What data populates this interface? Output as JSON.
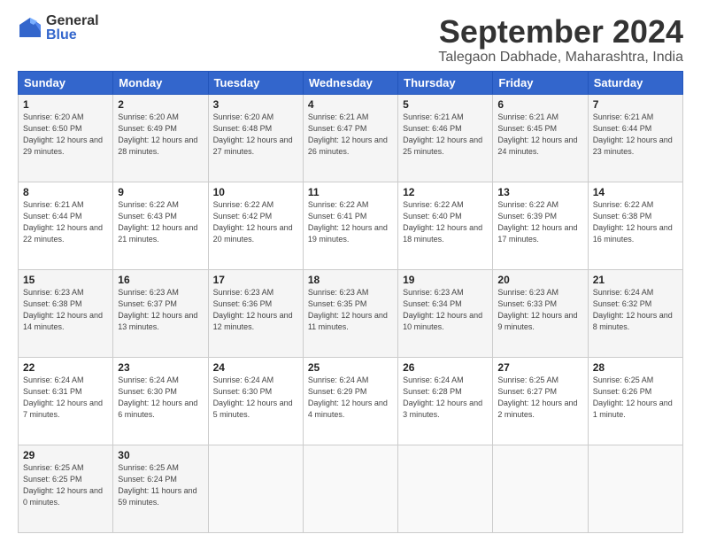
{
  "logo": {
    "general": "General",
    "blue": "Blue"
  },
  "title": "September 2024",
  "location": "Talegaon Dabhade, Maharashtra, India",
  "headers": [
    "Sunday",
    "Monday",
    "Tuesday",
    "Wednesday",
    "Thursday",
    "Friday",
    "Saturday"
  ],
  "weeks": [
    [
      {
        "day": "1",
        "sunrise": "Sunrise: 6:20 AM",
        "sunset": "Sunset: 6:50 PM",
        "daylight": "Daylight: 12 hours and 29 minutes."
      },
      {
        "day": "2",
        "sunrise": "Sunrise: 6:20 AM",
        "sunset": "Sunset: 6:49 PM",
        "daylight": "Daylight: 12 hours and 28 minutes."
      },
      {
        "day": "3",
        "sunrise": "Sunrise: 6:20 AM",
        "sunset": "Sunset: 6:48 PM",
        "daylight": "Daylight: 12 hours and 27 minutes."
      },
      {
        "day": "4",
        "sunrise": "Sunrise: 6:21 AM",
        "sunset": "Sunset: 6:47 PM",
        "daylight": "Daylight: 12 hours and 26 minutes."
      },
      {
        "day": "5",
        "sunrise": "Sunrise: 6:21 AM",
        "sunset": "Sunset: 6:46 PM",
        "daylight": "Daylight: 12 hours and 25 minutes."
      },
      {
        "day": "6",
        "sunrise": "Sunrise: 6:21 AM",
        "sunset": "Sunset: 6:45 PM",
        "daylight": "Daylight: 12 hours and 24 minutes."
      },
      {
        "day": "7",
        "sunrise": "Sunrise: 6:21 AM",
        "sunset": "Sunset: 6:44 PM",
        "daylight": "Daylight: 12 hours and 23 minutes."
      }
    ],
    [
      {
        "day": "8",
        "sunrise": "Sunrise: 6:21 AM",
        "sunset": "Sunset: 6:44 PM",
        "daylight": "Daylight: 12 hours and 22 minutes."
      },
      {
        "day": "9",
        "sunrise": "Sunrise: 6:22 AM",
        "sunset": "Sunset: 6:43 PM",
        "daylight": "Daylight: 12 hours and 21 minutes."
      },
      {
        "day": "10",
        "sunrise": "Sunrise: 6:22 AM",
        "sunset": "Sunset: 6:42 PM",
        "daylight": "Daylight: 12 hours and 20 minutes."
      },
      {
        "day": "11",
        "sunrise": "Sunrise: 6:22 AM",
        "sunset": "Sunset: 6:41 PM",
        "daylight": "Daylight: 12 hours and 19 minutes."
      },
      {
        "day": "12",
        "sunrise": "Sunrise: 6:22 AM",
        "sunset": "Sunset: 6:40 PM",
        "daylight": "Daylight: 12 hours and 18 minutes."
      },
      {
        "day": "13",
        "sunrise": "Sunrise: 6:22 AM",
        "sunset": "Sunset: 6:39 PM",
        "daylight": "Daylight: 12 hours and 17 minutes."
      },
      {
        "day": "14",
        "sunrise": "Sunrise: 6:22 AM",
        "sunset": "Sunset: 6:38 PM",
        "daylight": "Daylight: 12 hours and 16 minutes."
      }
    ],
    [
      {
        "day": "15",
        "sunrise": "Sunrise: 6:23 AM",
        "sunset": "Sunset: 6:38 PM",
        "daylight": "Daylight: 12 hours and 14 minutes."
      },
      {
        "day": "16",
        "sunrise": "Sunrise: 6:23 AM",
        "sunset": "Sunset: 6:37 PM",
        "daylight": "Daylight: 12 hours and 13 minutes."
      },
      {
        "day": "17",
        "sunrise": "Sunrise: 6:23 AM",
        "sunset": "Sunset: 6:36 PM",
        "daylight": "Daylight: 12 hours and 12 minutes."
      },
      {
        "day": "18",
        "sunrise": "Sunrise: 6:23 AM",
        "sunset": "Sunset: 6:35 PM",
        "daylight": "Daylight: 12 hours and 11 minutes."
      },
      {
        "day": "19",
        "sunrise": "Sunrise: 6:23 AM",
        "sunset": "Sunset: 6:34 PM",
        "daylight": "Daylight: 12 hours and 10 minutes."
      },
      {
        "day": "20",
        "sunrise": "Sunrise: 6:23 AM",
        "sunset": "Sunset: 6:33 PM",
        "daylight": "Daylight: 12 hours and 9 minutes."
      },
      {
        "day": "21",
        "sunrise": "Sunrise: 6:24 AM",
        "sunset": "Sunset: 6:32 PM",
        "daylight": "Daylight: 12 hours and 8 minutes."
      }
    ],
    [
      {
        "day": "22",
        "sunrise": "Sunrise: 6:24 AM",
        "sunset": "Sunset: 6:31 PM",
        "daylight": "Daylight: 12 hours and 7 minutes."
      },
      {
        "day": "23",
        "sunrise": "Sunrise: 6:24 AM",
        "sunset": "Sunset: 6:30 PM",
        "daylight": "Daylight: 12 hours and 6 minutes."
      },
      {
        "day": "24",
        "sunrise": "Sunrise: 6:24 AM",
        "sunset": "Sunset: 6:30 PM",
        "daylight": "Daylight: 12 hours and 5 minutes."
      },
      {
        "day": "25",
        "sunrise": "Sunrise: 6:24 AM",
        "sunset": "Sunset: 6:29 PM",
        "daylight": "Daylight: 12 hours and 4 minutes."
      },
      {
        "day": "26",
        "sunrise": "Sunrise: 6:24 AM",
        "sunset": "Sunset: 6:28 PM",
        "daylight": "Daylight: 12 hours and 3 minutes."
      },
      {
        "day": "27",
        "sunrise": "Sunrise: 6:25 AM",
        "sunset": "Sunset: 6:27 PM",
        "daylight": "Daylight: 12 hours and 2 minutes."
      },
      {
        "day": "28",
        "sunrise": "Sunrise: 6:25 AM",
        "sunset": "Sunset: 6:26 PM",
        "daylight": "Daylight: 12 hours and 1 minute."
      }
    ],
    [
      {
        "day": "29",
        "sunrise": "Sunrise: 6:25 AM",
        "sunset": "Sunset: 6:25 PM",
        "daylight": "Daylight: 12 hours and 0 minutes."
      },
      {
        "day": "30",
        "sunrise": "Sunrise: 6:25 AM",
        "sunset": "Sunset: 6:24 PM",
        "daylight": "Daylight: 11 hours and 59 minutes."
      },
      null,
      null,
      null,
      null,
      null
    ]
  ]
}
